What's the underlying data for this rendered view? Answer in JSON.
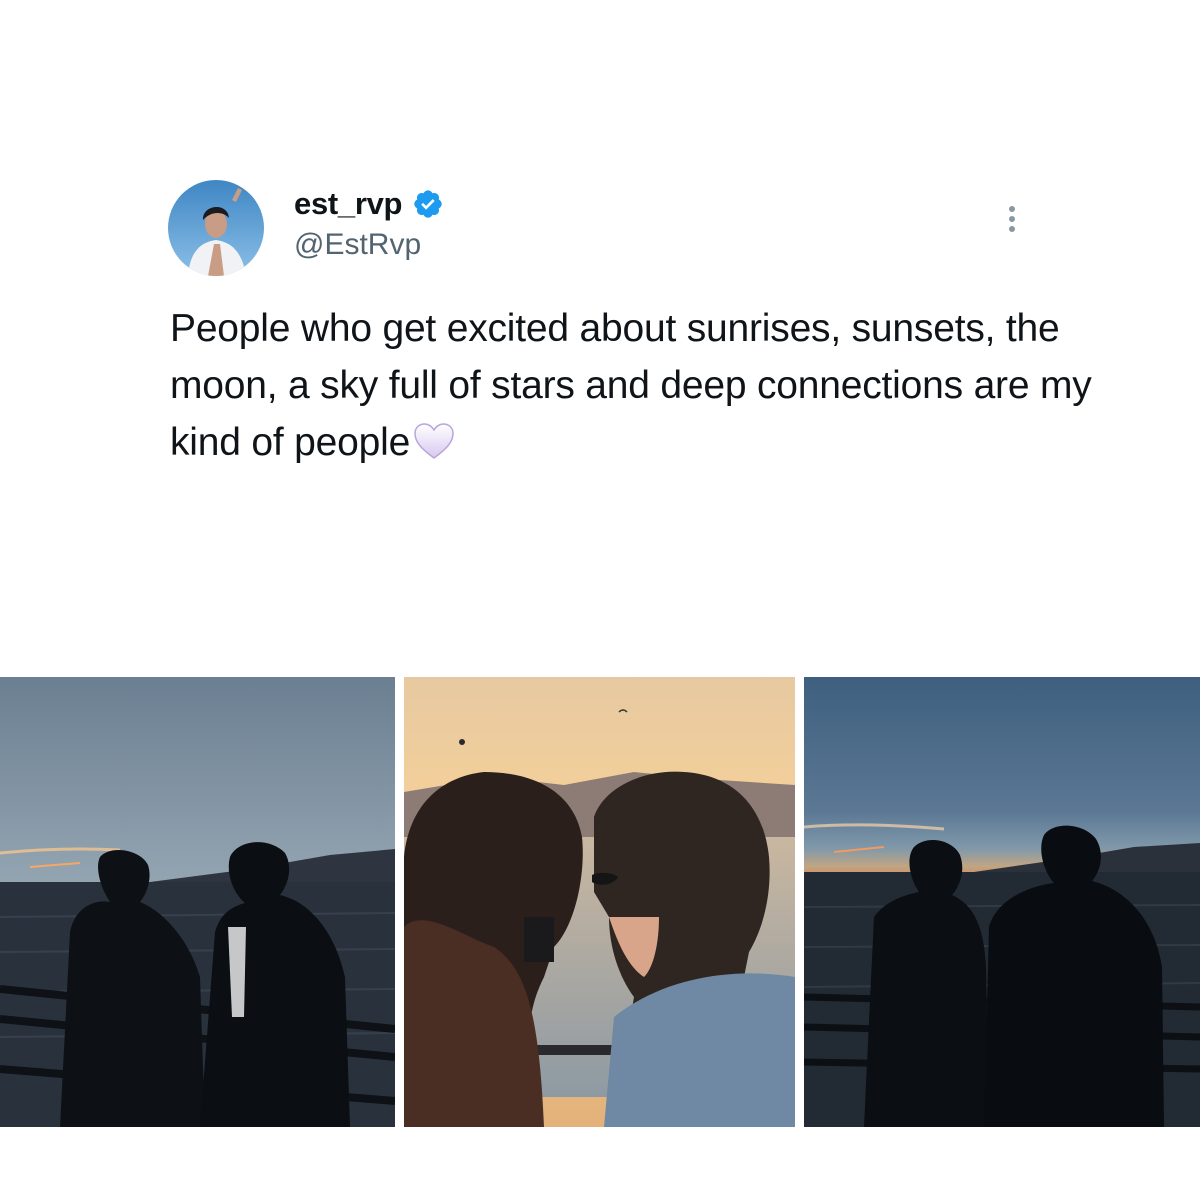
{
  "tweet": {
    "author": {
      "display_name": "est_rvp",
      "handle": "@EstRvp",
      "verified": true,
      "avatar_icon": "profile-photo"
    },
    "text": "People who get excited about sunrises, sunsets, the moon, a sky full of stars and deep connections are my kind of people",
    "emoji": "🤍",
    "more_icon": "more-vertical-icon",
    "media": [
      {
        "description_icon": "sunset-pier-photo"
      },
      {
        "description_icon": "sunset-closeup-photo"
      },
      {
        "description_icon": "dusk-pier-photo"
      }
    ]
  },
  "colors": {
    "text_primary": "#0f1419",
    "text_secondary": "#536471",
    "verified_blue": "#1d9bf0",
    "background": "#ffffff"
  }
}
